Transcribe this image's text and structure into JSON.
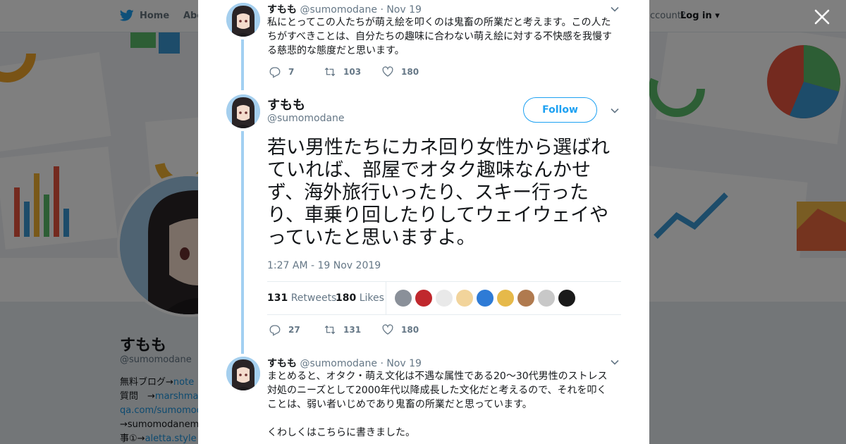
{
  "nav": {
    "home": "Home",
    "about": "Abo",
    "account": "ccount?",
    "login": "Log in"
  },
  "profile": {
    "name": "すもも",
    "handle": "@sumomodane",
    "bio": [
      {
        "text": "無料ブログ→",
        "link": "note"
      },
      {
        "text": "質問　→",
        "link": "marshma"
      },
      {
        "text": "",
        "link": "qa.com/sumomod"
      },
      {
        "text": "→sumomodanem",
        "link": ""
      },
      {
        "text": "事①→",
        "link": "aletta.style"
      }
    ]
  },
  "close_icon": "close-icon",
  "tweets": [
    {
      "name": "すもも",
      "handle": "@sumomodane",
      "date": "· Nov 19",
      "text": "私にとってこの人たちが萌え絵を叩くのは鬼畜の所業だと考えます。この人たちがすべきことは、自分たちの趣味に合わない萌え絵に対する不快感を我慢する慈悲的な態度だと思います。",
      "replies": "7",
      "retweets": "103",
      "likes": "180"
    },
    {
      "name": "すもも",
      "handle": "@sumomodane",
      "follow": "Follow",
      "text": "若い男性たちにカネ回り女性から選ばれていれば、部屋でオタク趣味なんかせず、海外旅行いったり、スキー行ったり、車乗り回したりしてウェイウェイやっていたと思いますよ。",
      "time": "1:27 AM - 19 Nov 2019",
      "retweets_count": "131",
      "retweets_label": "Retweets",
      "likes_count": "180",
      "likes_label": "Likes",
      "replies": "27",
      "retweets": "131",
      "likes": "180"
    },
    {
      "name": "すもも",
      "handle": "@sumomodane",
      "date": "· Nov 19",
      "text": "まとめると、オタク・萌え文化は不遇な属性である20～30代男性のストレス対処のニーズとして2000年代以降成長した文化だと考えるので、それを叩くことは、弱い者いじめであり鬼畜の所業だと思っています。",
      "text2": "くわしくはこちらに書きました。"
    }
  ],
  "colors": {
    "accent": "#1da1f2",
    "thread_line": "#a2d0f2",
    "muted": "#657786",
    "text": "#14171a"
  },
  "likers": [
    {
      "color": "#8a9099"
    },
    {
      "color": "#c0282d"
    },
    {
      "color": "#e9e9e9"
    },
    {
      "color": "#f2d49b"
    },
    {
      "color": "#2e7bd6"
    },
    {
      "color": "#e6b94a"
    },
    {
      "color": "#b07a4f"
    },
    {
      "color": "#c8c8c8"
    },
    {
      "color": "#1a1a1a"
    }
  ]
}
